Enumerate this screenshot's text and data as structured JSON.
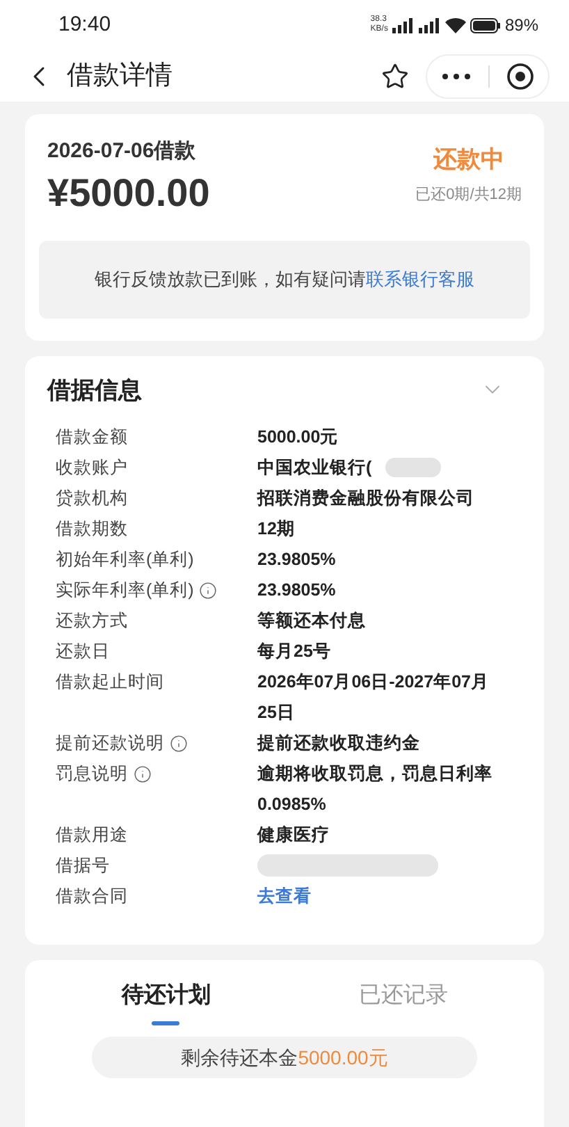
{
  "status_bar": {
    "time": "19:40",
    "speed": "38.3",
    "speed_unit": "KB/s",
    "battery": "89%"
  },
  "header": {
    "title": "借款详情"
  },
  "summary": {
    "date_label": "2026-07-06借款",
    "amount": "¥5000.00",
    "status": "还款中",
    "progress": "已还0期/共12期",
    "notice": "银行反馈放款已到账，如有疑问请",
    "notice_link": "联系银行客服"
  },
  "loan_info": {
    "title": "借据信息",
    "expanded": true,
    "rows": [
      {
        "label": "借款金额",
        "value": "5000.00元",
        "info": false,
        "redacted": false,
        "kind": "text"
      },
      {
        "label": "收款账户",
        "value": "中国农业银行(",
        "info": false,
        "redacted": true,
        "kind": "text"
      },
      {
        "label": "贷款机构",
        "value": "招联消费金融股份有限公司",
        "info": false,
        "redacted": false,
        "kind": "text"
      },
      {
        "label": "借款期数",
        "value": "12期",
        "info": false,
        "redacted": false,
        "kind": "text"
      },
      {
        "label": "初始年利率(单利)",
        "value": "23.9805%",
        "info": false,
        "redacted": false,
        "kind": "text"
      },
      {
        "label": "实际年利率(单利)",
        "value": "23.9805%",
        "info": true,
        "redacted": false,
        "kind": "text"
      },
      {
        "label": "还款方式",
        "value": "等额还本付息",
        "info": false,
        "redacted": false,
        "kind": "text"
      },
      {
        "label": "还款日",
        "value": "每月25号",
        "info": false,
        "redacted": false,
        "kind": "text"
      },
      {
        "label": "借款起止时间",
        "value": "2026年07月06日-2027年07月25日",
        "info": false,
        "redacted": false,
        "kind": "text"
      },
      {
        "label": "提前还款说明",
        "value": "提前还款收取违约金",
        "info": true,
        "redacted": false,
        "kind": "text"
      },
      {
        "label": "罚息说明",
        "value": "逾期将收取罚息，罚息日利率0.0985%",
        "info": true,
        "redacted": false,
        "kind": "text"
      },
      {
        "label": "借款用途",
        "value": "健康医疗",
        "info": false,
        "redacted": false,
        "kind": "text"
      },
      {
        "label": "借据号",
        "info": false,
        "redacted": true,
        "kind": "text"
      },
      {
        "label": "借款合同",
        "value": "去查看",
        "info": false,
        "redacted": false,
        "kind": "link"
      }
    ]
  },
  "plan": {
    "tabs": [
      {
        "label": "待还计划",
        "selected": true
      },
      {
        "label": "已还记录",
        "selected": false
      }
    ],
    "remaining_label": "剩余待还本金",
    "remaining_amount": "5000.00元"
  }
}
